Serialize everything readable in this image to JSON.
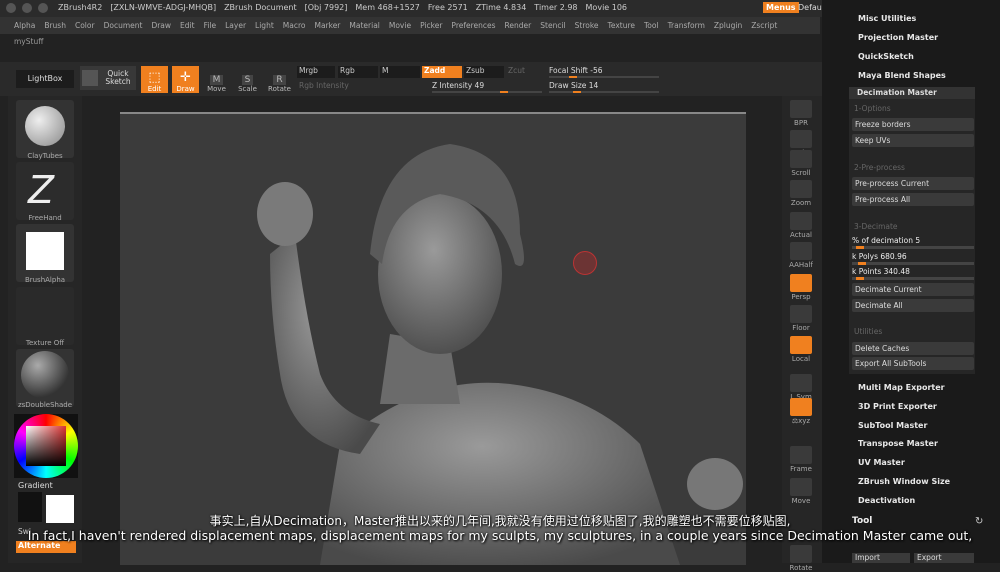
{
  "titlebar": {
    "app": "ZBrush4R2",
    "serial": "[ZXLN-WMVE-ADGJ-MHQB]",
    "document": "ZBrush Document",
    "obj": "[Obj 7992]",
    "mem": "Mem 468+1527",
    "free": "Free 2571",
    "ztime": "ZTime 4.834",
    "timer": "Timer 2.98",
    "movie": "Movie 106",
    "menus": "Menus",
    "script": "DefaultZScript"
  },
  "menubar": [
    "Alpha",
    "Brush",
    "Color",
    "Document",
    "Draw",
    "Edit",
    "File",
    "Layer",
    "Light",
    "Macro",
    "Marker",
    "Material",
    "Movie",
    "Picker",
    "Preferences",
    "Render",
    "Stencil",
    "Stroke",
    "Texture",
    "Tool",
    "Transform",
    "Zplugin",
    "Zscript"
  ],
  "mystuff": "myStuff",
  "toolbar": {
    "lightbox": "LightBox",
    "quicksketch": "Quick Sketch",
    "edit": "Edit",
    "draw": "Draw",
    "move": "Move",
    "scale": "Scale",
    "rotate": "Rotate",
    "move_icon": "M",
    "scale_icon": "S",
    "rotate_icon": "R",
    "mrgb": "Mrgb",
    "rgb": "Rgb",
    "m": "M",
    "rgb_intensity": "Rgb Intensity",
    "zadd": "Zadd",
    "zsub": "Zsub",
    "zcut": "Zcut",
    "z_intensity": "Z Intensity 49",
    "focal_shift": "Focal Shift -56",
    "draw_size": "Draw Size 14"
  },
  "left": {
    "brush": "ClayTubes",
    "stroke": "FreeHand",
    "alpha": "BrushAlpha",
    "texture": "Texture Off",
    "material": "zsDoubleShade",
    "gradient": "Gradient",
    "switch": "Swi",
    "alternate": "Alternate"
  },
  "rightshelf": {
    "bpr": "BPR",
    "spix": "SPix",
    "scroll": "Scroll",
    "zoom": "Zoom",
    "actual": "Actual",
    "aahalf": "AAHalf",
    "persp": "Persp",
    "floor": "Floor",
    "local": "Local",
    "lsym": "L.Sym",
    "xyz": "⚖xyz",
    "frame": "Frame",
    "move": "Move",
    "rotate": "Rotate"
  },
  "zplugin": {
    "top_items": [
      "Misc Utilities",
      "Projection Master",
      "QuickSketch",
      "Maya Blend Shapes"
    ],
    "dm_title": "Decimation Master",
    "options_hdr": "1-Options",
    "freeze": "Freeze borders",
    "keepuvs": "Keep UVs",
    "preprocess_hdr": "2-Pre-process",
    "pre_current": "Pre-process Current",
    "pre_all": "Pre-process All",
    "decimate_hdr": "3-Decimate",
    "pct": "% of decimation 5",
    "kpolys": "k Polys 680.96",
    "kpoints": "k Points 340.48",
    "dec_current": "Decimate Current",
    "dec_all": "Decimate All",
    "util_hdr": "Utilities",
    "delete_caches": "Delete Caches",
    "export_all": "Export All SubTools",
    "bottom_items": [
      "Multi Map Exporter",
      "3D Print Exporter",
      "SubTool Master",
      "Transpose Master",
      "UV Master",
      "ZBrush Window Size",
      "Deactivation"
    ],
    "tool": "Tool",
    "import": "Import",
    "export": "Export"
  },
  "subtitles": {
    "zh": "事实上,自从Decimation，Master推出以来的几年间,我就没有使用过位移贴图了,我的雕塑也不需要位移贴图,",
    "en": "In fact,I haven't rendered displacement maps, displacement maps for my sculpts, my sculptures, in a couple years since Decimation Master came out,"
  },
  "colors": {
    "accent": "#f0801f",
    "panel": "#1a1a1a",
    "canvas": "#3a3a3a"
  }
}
